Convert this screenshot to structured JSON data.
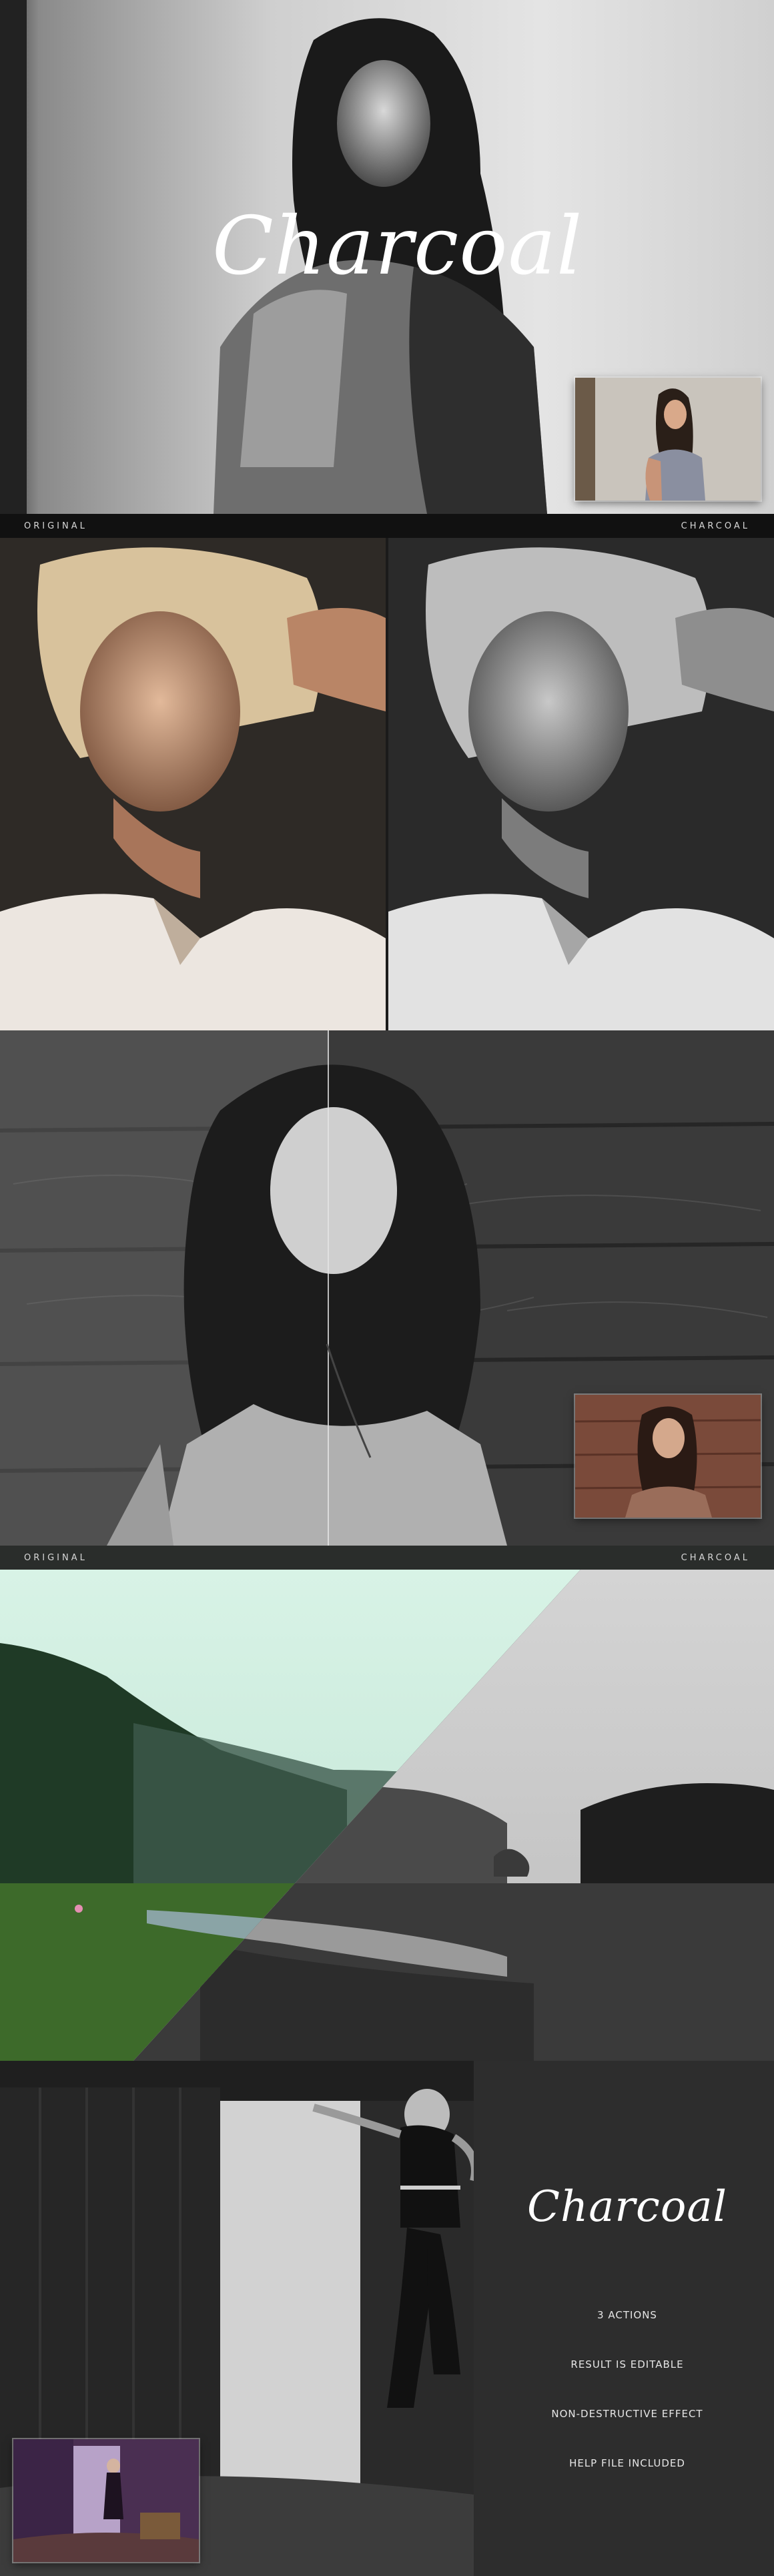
{
  "hero": {
    "title": "Charcoal"
  },
  "compare_portrait": {
    "left_label": "ORIGINAL",
    "right_label": "CHARCOAL"
  },
  "compare_landscape": {
    "left_label": "ORIGINAL",
    "right_label": "CHARCOAL"
  },
  "promo": {
    "title": "Charcoal",
    "features": [
      "3 ACTIONS",
      "RESULT IS EDITABLE",
      "NON-DESTRUCTIVE EFFECT",
      "HELP FILE INCLUDED"
    ]
  }
}
